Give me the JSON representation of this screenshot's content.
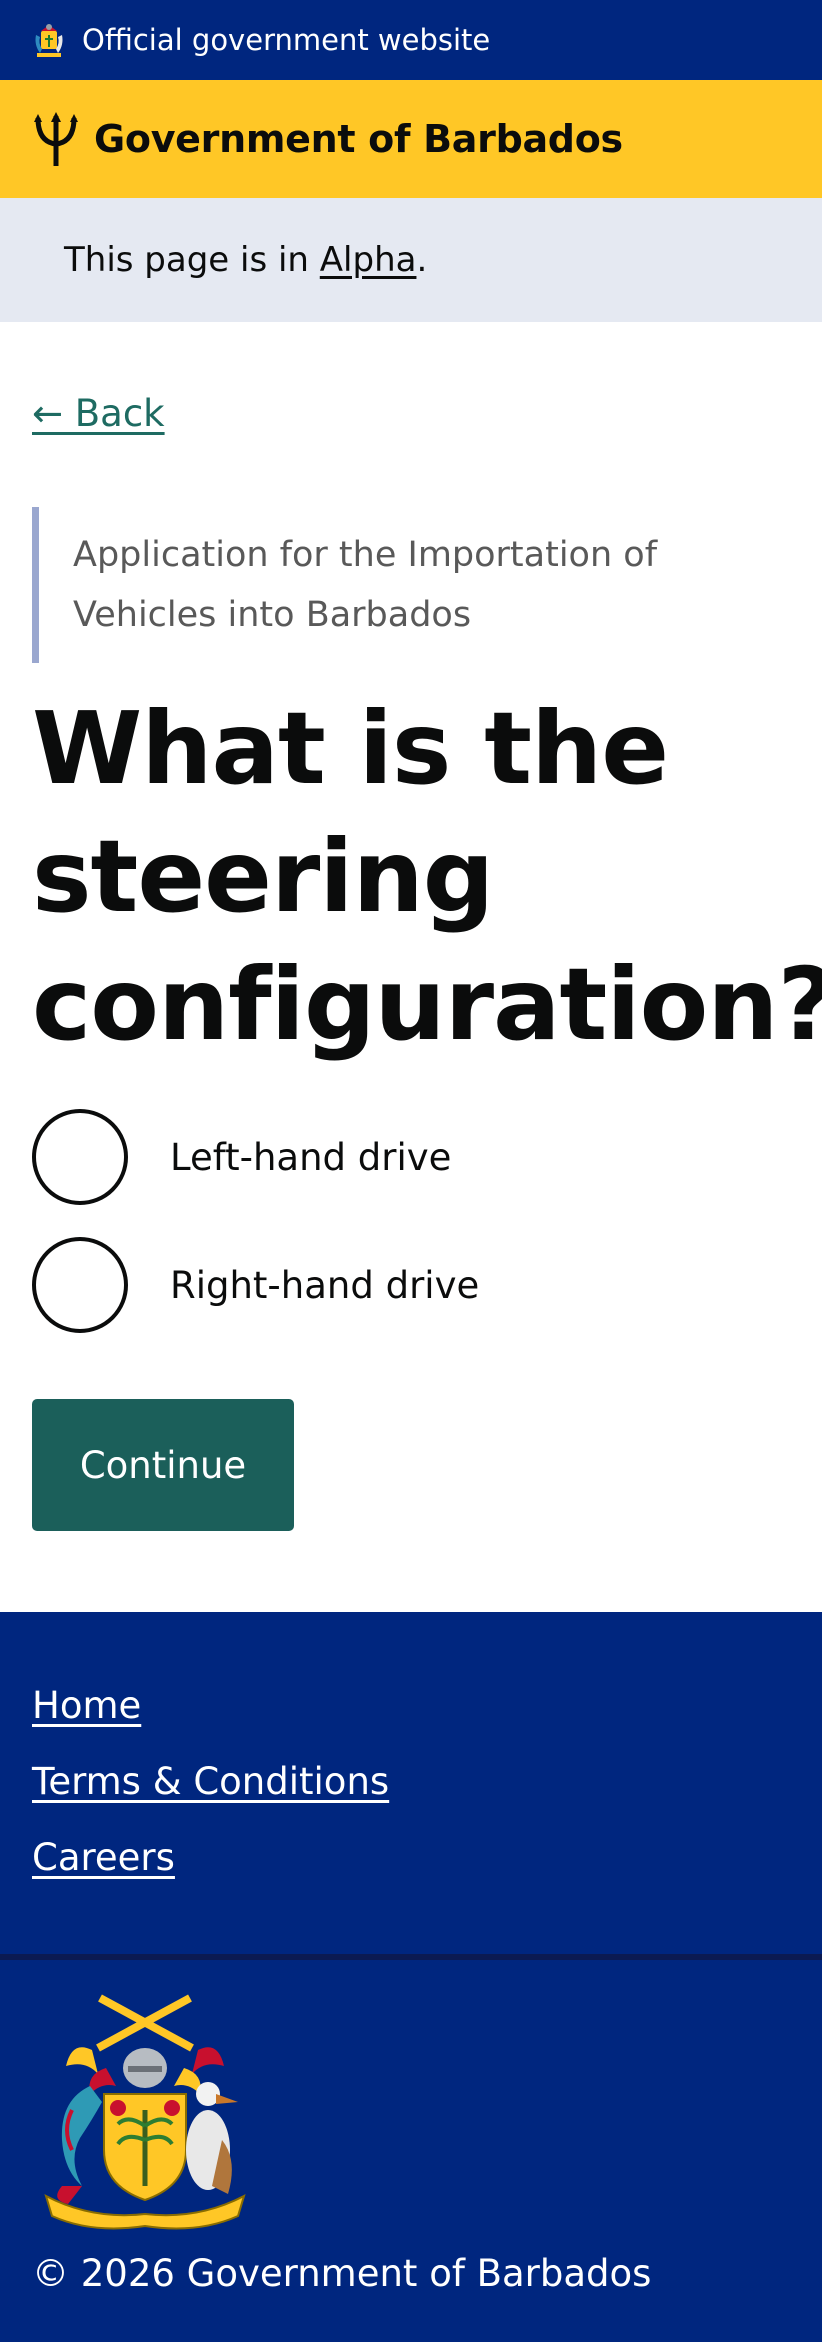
{
  "official_banner": {
    "text": "Official government website"
  },
  "brand": {
    "name": "Government of Barbados"
  },
  "phase": {
    "prefix": "This page is in ",
    "phase_link": "Alpha",
    "suffix": "."
  },
  "back_link": {
    "label": "← Back"
  },
  "question": {
    "caption_lines": [
      "Application for the Importation of",
      "Vehicles into Barbados"
    ],
    "heading_lines": [
      "What is the",
      "steering",
      "configuration?"
    ]
  },
  "options": [
    {
      "label": "Left-hand drive",
      "selected": false
    },
    {
      "label": "Right-hand drive",
      "selected": false
    }
  ],
  "continue_label": "Continue",
  "footer": {
    "links": [
      "Home",
      "Terms & Conditions",
      "Careers"
    ],
    "copyright": "© 2026 Government of Barbados"
  },
  "colors": {
    "gov_blue": "#00267f",
    "brand_yellow": "#ffc726",
    "phase_bg": "#e5e9f2",
    "link_teal": "#1e6b62",
    "button_teal": "#1b5f5a"
  },
  "icons": {
    "official_banner": "coat-of-arms-icon",
    "brand": "trident-icon",
    "footer": "coat-of-arms-icon"
  }
}
